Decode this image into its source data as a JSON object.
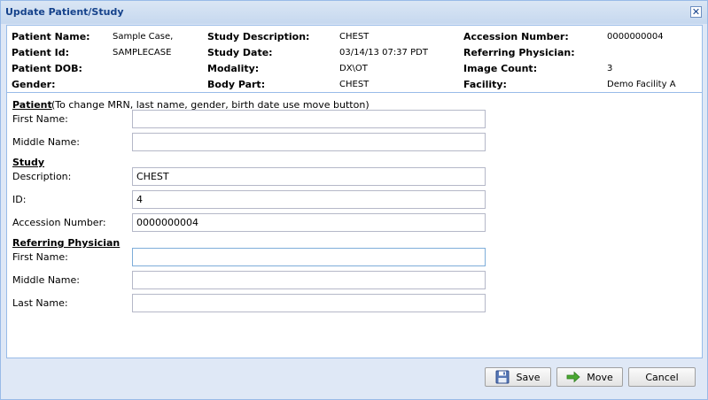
{
  "window": {
    "title": "Update Patient/Study",
    "close_icon": "close-icon"
  },
  "study_info": {
    "patient_name_label": "Patient Name:",
    "patient_name": "Sample Case,",
    "patient_id_label": "Patient Id:",
    "patient_id": "SAMPLECASE",
    "patient_dob_label": "Patient DOB:",
    "patient_dob": "",
    "gender_label": "Gender:",
    "gender": "",
    "study_description_label": "Study Description:",
    "study_description": "CHEST",
    "study_date_label": "Study Date:",
    "study_date": "03/14/13 07:37 PDT",
    "modality_label": "Modality:",
    "modality": "DX\\OT",
    "body_part_label": "Body Part:",
    "body_part": "CHEST",
    "accession_number_label": "Accession Number:",
    "accession_number": "0000000004",
    "referring_physician_label": "Referring Physician:",
    "referring_physician": "",
    "image_count_label": "Image Count:",
    "image_count": "3",
    "facility_label": "Facility:",
    "facility": "Demo Facility A"
  },
  "form": {
    "patient_section": "Patient",
    "patient_note": "(To change MRN, last name, gender, birth date use move button)",
    "patient_first_name_label": "First Name:",
    "patient_first_name": "",
    "patient_middle_name_label": "Middle Name:",
    "patient_middle_name": "",
    "study_section": "Study",
    "study_description_label": "Description:",
    "study_description": "CHEST",
    "study_id_label": "ID:",
    "study_id": "4",
    "study_accession_label": "Accession Number:",
    "study_accession": "0000000004",
    "referring_section": "Referring Physician",
    "ref_first_name_label": "First Name:",
    "ref_first_name": "",
    "ref_middle_name_label": "Middle Name:",
    "ref_middle_name": "",
    "ref_last_name_label": "Last Name:",
    "ref_last_name": ""
  },
  "buttons": {
    "save": "Save",
    "save_icon": "floppy-disk-icon",
    "move": "Move",
    "move_icon": "arrow-right-icon",
    "cancel": "Cancel"
  }
}
